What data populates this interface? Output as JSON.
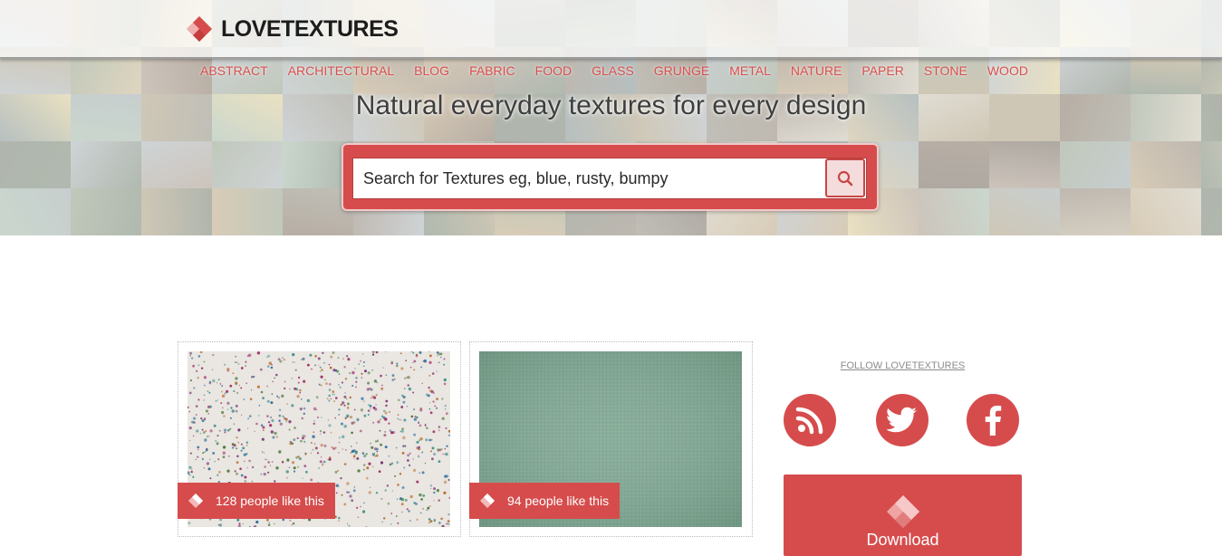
{
  "site": {
    "logo_text": "LOVETEXTURES",
    "tagline": "Natural everyday textures for every design"
  },
  "nav": {
    "items": [
      {
        "label": "ABSTRACT"
      },
      {
        "label": "ARCHITECTURAL"
      },
      {
        "label": "BLOG"
      },
      {
        "label": "FABRIC"
      },
      {
        "label": "FOOD"
      },
      {
        "label": "GLASS"
      },
      {
        "label": "GRUNGE"
      },
      {
        "label": "METAL"
      },
      {
        "label": "NATURE"
      },
      {
        "label": "PAPER"
      },
      {
        "label": "STONE"
      },
      {
        "label": "WOOD"
      }
    ]
  },
  "search": {
    "placeholder": "Search for Textures eg, blue, rusty, bumpy",
    "button_icon": "search-icon"
  },
  "cards": [
    {
      "likes_text": "128 people like this",
      "texture": "glitter-on-white"
    },
    {
      "likes_text": "94 people like this",
      "texture": "green-linen"
    }
  ],
  "sidebar": {
    "follow_label": "FOLLOW LOVETEXTURES",
    "social": [
      {
        "icon": "rss-icon"
      },
      {
        "icon": "twitter-icon"
      },
      {
        "icon": "facebook-icon"
      }
    ],
    "download_label": "Download"
  },
  "colors": {
    "accent": "#d64c4c",
    "accent_light": "#f4dcdc",
    "nav_text": "#d8504f",
    "logo_text": "#1c1c1c"
  }
}
